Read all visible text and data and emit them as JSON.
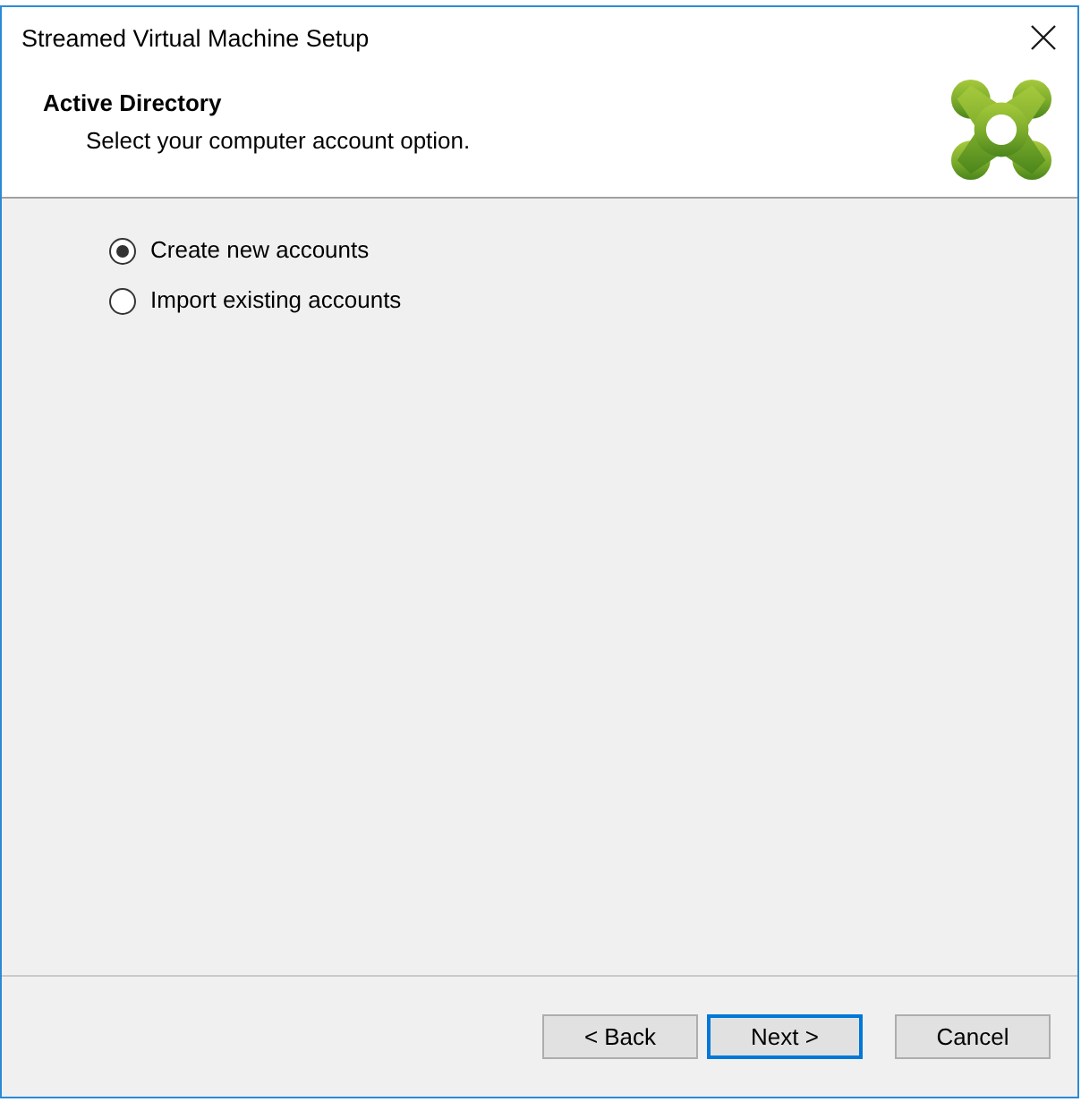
{
  "window": {
    "title": "Streamed Virtual Machine Setup"
  },
  "header": {
    "title": "Active Directory",
    "subtitle": "Select your computer account option."
  },
  "options": [
    {
      "label": "Create new accounts",
      "selected": true
    },
    {
      "label": "Import existing accounts",
      "selected": false
    }
  ],
  "buttons": [
    {
      "label": "< Back",
      "default": false
    },
    {
      "label": "Next >",
      "default": true
    },
    {
      "label": "Cancel",
      "default": false
    }
  ]
}
